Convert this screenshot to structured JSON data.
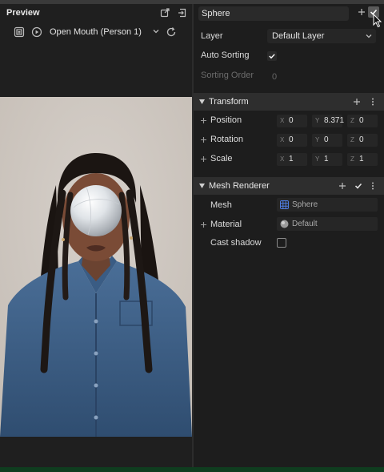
{
  "preview": {
    "title": "Preview",
    "trigger_dropdown": "Open Mouth (Person 1)"
  },
  "inspector": {
    "object_name": "Sphere",
    "layer": {
      "label": "Layer",
      "value": "Default Layer"
    },
    "auto_sorting": {
      "label": "Auto Sorting",
      "checked": true
    },
    "sorting_order": {
      "label": "Sorting Order",
      "value": "0"
    },
    "transform": {
      "title": "Transform",
      "position": {
        "label": "Position",
        "x": "0",
        "y": "8.371",
        "z": "0"
      },
      "rotation": {
        "label": "Rotation",
        "x": "0",
        "y": "0",
        "z": "0"
      },
      "scale": {
        "label": "Scale",
        "x": "1",
        "y": "1",
        "z": "1"
      }
    },
    "mesh_renderer": {
      "title": "Mesh Renderer",
      "mesh": {
        "label": "Mesh",
        "value": "Sphere"
      },
      "material": {
        "label": "Material",
        "value": "Default"
      },
      "cast_shadow": {
        "label": "Cast shadow",
        "checked": false
      }
    }
  },
  "axis_labels": {
    "x": "X",
    "y": "Y",
    "z": "Z"
  },
  "colors": {
    "background": "#1b1b1b",
    "section_header": "#2e2e2e",
    "field": "#262626",
    "status_strip": "#0f3d1f"
  }
}
